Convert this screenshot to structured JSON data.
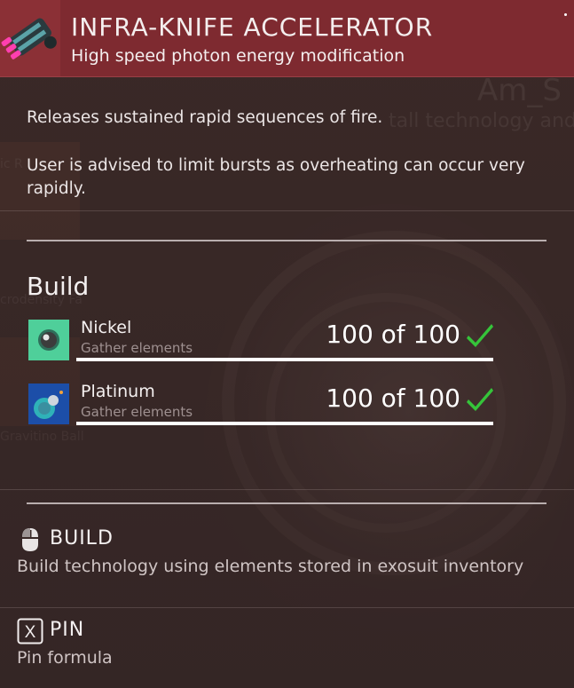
{
  "header": {
    "title": "INFRA-KNIFE ACCELERATOR",
    "subtitle": "High speed photon energy modification"
  },
  "description": {
    "line1": "Releases sustained rapid sequences of fire.",
    "line2": "User is advised to limit bursts as overheating can occur very rapidly."
  },
  "build": {
    "heading": "Build",
    "items": [
      {
        "name": "Nickel",
        "sub": "Gather elements",
        "count": "100 of 100",
        "icon": "nickel-orb-icon",
        "progress": 1.0
      },
      {
        "name": "Platinum",
        "sub": "Gather elements",
        "count": "100 of 100",
        "icon": "platinum-orb-icon",
        "progress": 1.0
      }
    ]
  },
  "actions": {
    "build": {
      "label": "BUILD",
      "desc": "Build technology using elements stored in exosuit inventory",
      "icon": "mouse-icon"
    },
    "pin": {
      "label": "PIN",
      "desc": "Pin formula",
      "icon": "x-key-icon",
      "key": "X"
    }
  },
  "colors": {
    "header": "#7e2a30",
    "check": "#35c43a",
    "panel": "#3a2a28"
  }
}
